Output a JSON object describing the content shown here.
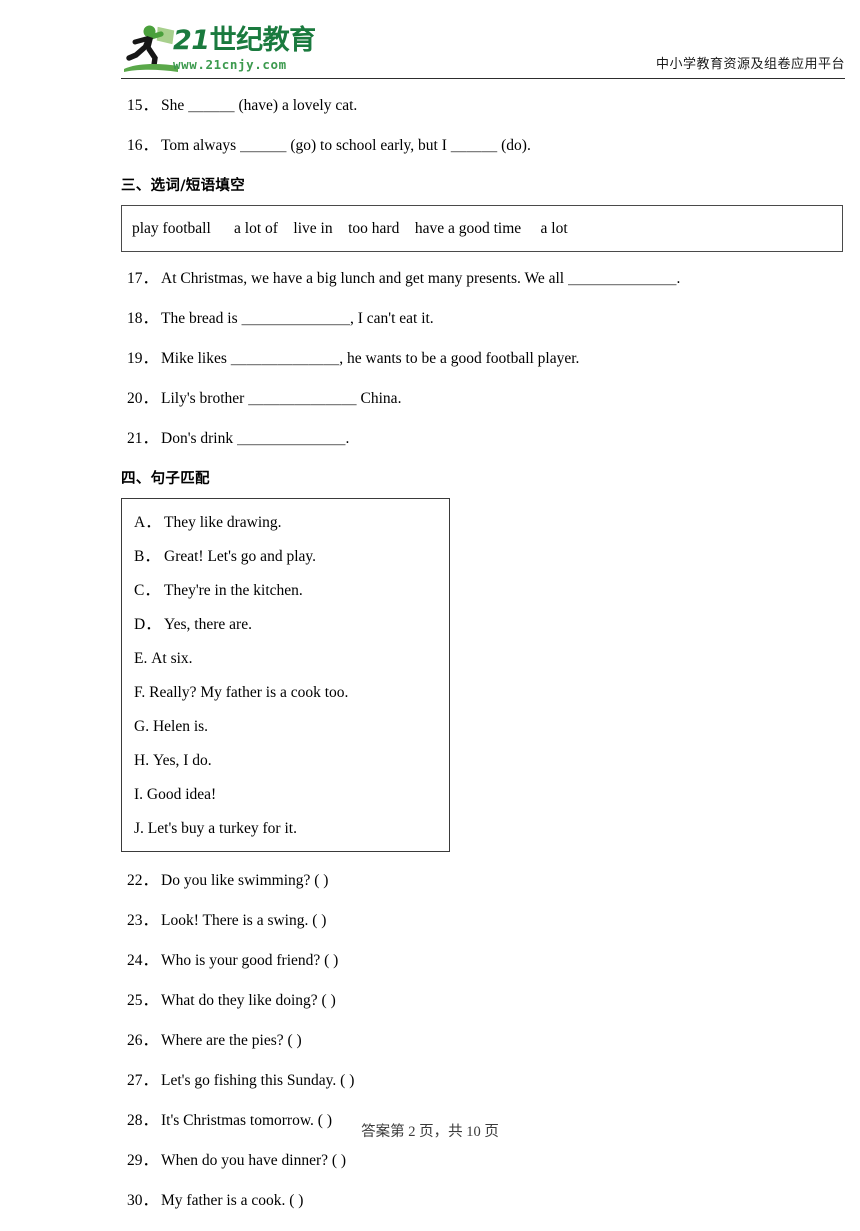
{
  "header": {
    "logo": {
      "brand_cn": "21世纪教育",
      "brand_num": "21",
      "brand_cn_rest": "世纪教育",
      "url": "www.21cnjy.com",
      "runner_icon": "running-person-with-book-icon",
      "green_dark": "#1a7a3e",
      "green_light": "#7cbf6a"
    },
    "tagline": "中小学教育资源及组卷应用平台"
  },
  "fill_in_questions_top": [
    {
      "num": "15．",
      "text": "She ＿＿＿ (have) a lovely cat."
    },
    {
      "num": "16．",
      "text": "Tom always ＿＿＿ (go) to school early, but I ＿＿＿ (do)."
    }
  ],
  "section_three": {
    "heading": "三、选词/短语填空",
    "wordbank": "play football      a lot of    live in    too hard    have a good time     a lot",
    "wordbank_items": [
      "play football",
      "a lot of",
      "live in",
      "too hard",
      "have a good time",
      "a lot"
    ],
    "questions": [
      {
        "num": "17．",
        "text": "At Christmas, we have a big lunch and get many presents. We all ＿＿＿＿＿＿＿."
      },
      {
        "num": "18．",
        "text": "The bread is ＿＿＿＿＿＿＿, I can't eat it."
      },
      {
        "num": "19．",
        "text": "Mike likes ＿＿＿＿＿＿＿, he wants to be a good football player."
      },
      {
        "num": "20．",
        "text": "Lily's brother ＿＿＿＿＿＿＿ China."
      },
      {
        "num": "21．",
        "text": "Don's drink ＿＿＿＿＿＿＿."
      }
    ]
  },
  "section_four": {
    "heading": "四、句子匹配",
    "options": [
      {
        "letter": "A．",
        "wide": true,
        "text": "They like drawing."
      },
      {
        "letter": "B．",
        "wide": true,
        "text": "Great! Let's go and play."
      },
      {
        "letter": "C．",
        "wide": true,
        "text": "They're in the kitchen."
      },
      {
        "letter": "D．",
        "wide": true,
        "text": "Yes, there are."
      },
      {
        "letter": "E.",
        "wide": false,
        "text": "At six."
      },
      {
        "letter": "F.",
        "wide": false,
        "text": "Really? My father is a cook too."
      },
      {
        "letter": "G.",
        "wide": false,
        "text": "Helen is."
      },
      {
        "letter": "H.",
        "wide": false,
        "text": "Yes, I do."
      },
      {
        "letter": "I.",
        "wide": false,
        "text": "Good idea!"
      },
      {
        "letter": "J.",
        "wide": false,
        "text": "Let's buy a turkey for it."
      }
    ],
    "questions": [
      {
        "num": "22．",
        "text": "Do you like swimming? (            )"
      },
      {
        "num": "23．",
        "text": "Look! There is a swing. (            )"
      },
      {
        "num": "24．",
        "text": "Who is your good friend? (             )"
      },
      {
        "num": "25．",
        "text": "What do they like doing? (             )"
      },
      {
        "num": "26．",
        "text": "Where are the pies? (           )"
      },
      {
        "num": "27．",
        "text": "Let's go fishing this Sunday. (             )"
      },
      {
        "num": "28．",
        "text": "It's Christmas tomorrow. (            )"
      },
      {
        "num": "29．",
        "text": "When do you have dinner? (            )"
      },
      {
        "num": "30．",
        "text": "My father is a cook. (           )"
      }
    ]
  },
  "footer": {
    "text": "答案第 2 页，共 10 页"
  }
}
